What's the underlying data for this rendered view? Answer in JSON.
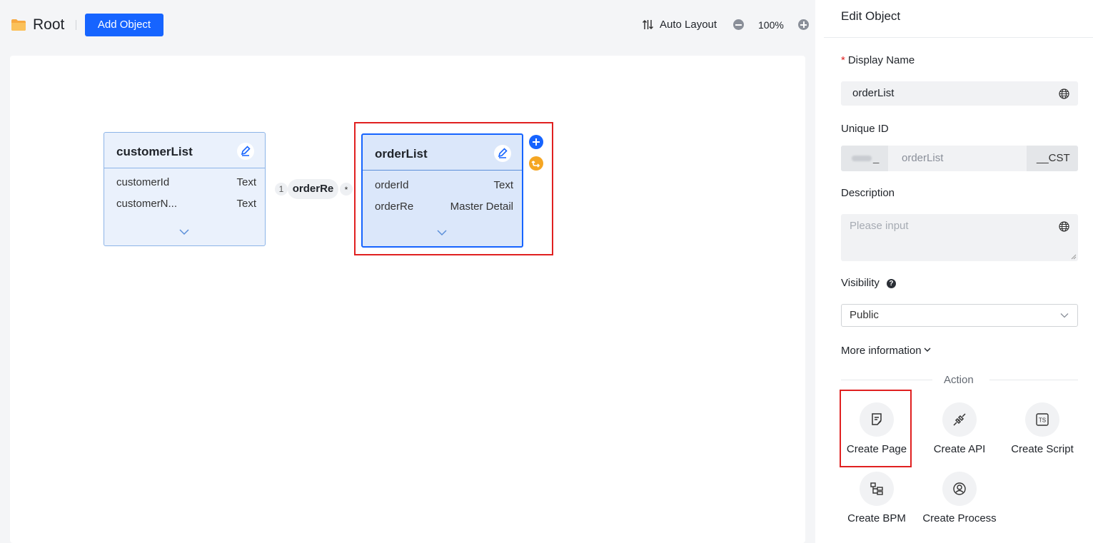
{
  "header": {
    "title": "Root",
    "add_object_label": "Add Object",
    "auto_layout_label": "Auto Layout",
    "zoom": "100%"
  },
  "canvas": {
    "objects": [
      {
        "name": "customerList",
        "fields": [
          {
            "name": "customerId",
            "type": "Text"
          },
          {
            "name": "customerN...",
            "type": "Text"
          }
        ]
      },
      {
        "name": "orderList",
        "fields": [
          {
            "name": "orderId",
            "type": "Text"
          },
          {
            "name": "orderRe",
            "type": "Master Detail"
          }
        ]
      }
    ],
    "relation": {
      "label": "orderRe",
      "from_cardinality": "1",
      "to_cardinality": "*"
    }
  },
  "panel": {
    "title": "Edit Object",
    "display_name_label": "Display Name",
    "display_name_value": "orderList",
    "unique_id_label": "Unique ID",
    "unique_id_value": "orderList",
    "unique_id_suffix": "__CST",
    "description_label": "Description",
    "description_placeholder": "Please input",
    "visibility_label": "Visibility",
    "visibility_value": "Public",
    "more_info_label": "More information",
    "action_title": "Action",
    "actions": [
      {
        "label": "Create Page",
        "icon": "page-icon"
      },
      {
        "label": "Create API",
        "icon": "api-plug-icon"
      },
      {
        "label": "Create Script",
        "icon": "ts-script-icon"
      },
      {
        "label": "Create BPM",
        "icon": "bpm-tree-icon"
      },
      {
        "label": "Create Process",
        "icon": "process-icon"
      }
    ]
  },
  "colors": {
    "primary": "#1664ff",
    "highlight": "#e02020",
    "secondary_action": "#f5a623"
  }
}
